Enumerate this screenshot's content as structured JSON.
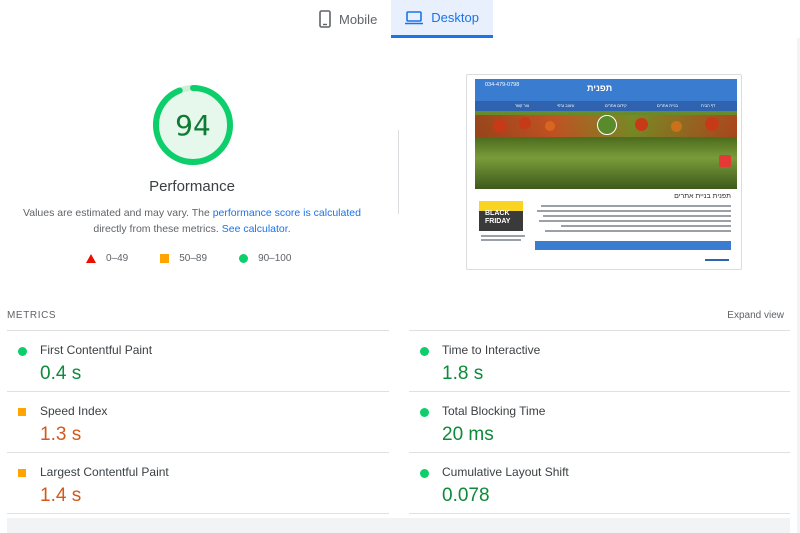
{
  "tabs": [
    {
      "label": "Mobile",
      "icon": "mobile-icon",
      "active": false
    },
    {
      "label": "Desktop",
      "icon": "desktop-icon",
      "active": true
    }
  ],
  "summary": {
    "score": "94",
    "score_fraction": 0.94,
    "title": "Performance",
    "note_prefix": "Values are estimated and may vary. The ",
    "note_link_1": "performance score is calculated",
    "note_middle": " directly from these metrics. ",
    "note_link_2": "See calculator."
  },
  "legend": [
    {
      "range": "0–49",
      "shape": "triangle",
      "color": "#eb0f00"
    },
    {
      "range": "50–89",
      "shape": "square",
      "color": "#ffa400"
    },
    {
      "range": "90–100",
      "shape": "circle",
      "color": "#0cce6b"
    }
  ],
  "preview": {
    "phone": "034-479-0798",
    "logo": "תפנית",
    "heading": "תפנית בניית אתרים",
    "nav": [
      "דף הבית",
      "בניית אתרים",
      "קידום אתרים",
      "עיצוב גרפי",
      "צור קשר"
    ],
    "promo": "BLACK FRIDAY"
  },
  "metrics": {
    "label": "METRICS",
    "expand_label": "Expand view",
    "items": [
      {
        "name": "First Contentful Paint",
        "value": "0.4 s",
        "status": "good"
      },
      {
        "name": "Time to Interactive",
        "value": "1.8 s",
        "status": "good"
      },
      {
        "name": "Speed Index",
        "value": "1.3 s",
        "status": "average"
      },
      {
        "name": "Total Blocking Time",
        "value": "20 ms",
        "status": "good"
      },
      {
        "name": "Largest Contentful Paint",
        "value": "1.4 s",
        "status": "average"
      },
      {
        "name": "Cumulative Layout Shift",
        "value": "0.078",
        "status": "good"
      }
    ]
  },
  "colors": {
    "accent": "#1a73e8",
    "good": "#0cce6b",
    "average": "#ffa400",
    "fail": "#eb0f00"
  }
}
